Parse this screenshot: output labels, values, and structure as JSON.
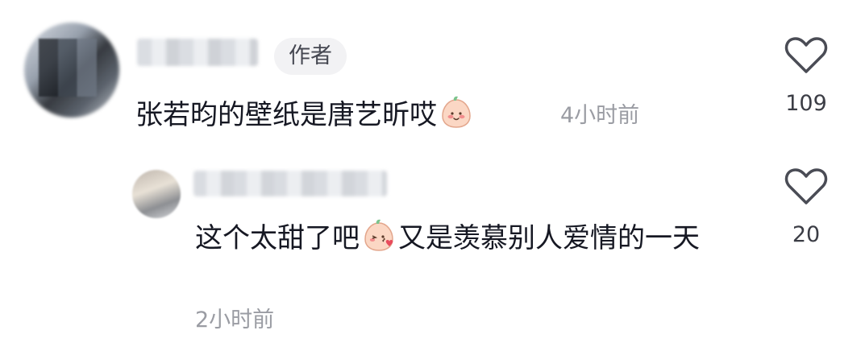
{
  "comments": [
    {
      "author_badge": "作者",
      "text_before_emoji": "张若昀的壁纸是唐艺昕哎",
      "emoji_icon": "smiling-face-emoji-icon",
      "time": "4小时前",
      "like_icon": "heart-outline-icon",
      "likes": "109"
    }
  ],
  "replies": [
    {
      "text_part1": "这个太甜了吧",
      "emoji_icon": "kissing-face-emoji-icon",
      "text_part2": "又是羡慕别人爱情的一天",
      "time": "2小时前",
      "like_icon": "heart-outline-icon",
      "likes": "20"
    }
  ],
  "colors": {
    "text": "#161823",
    "secondary": "#9a9ca3",
    "badge_bg": "#f2f2f4"
  }
}
